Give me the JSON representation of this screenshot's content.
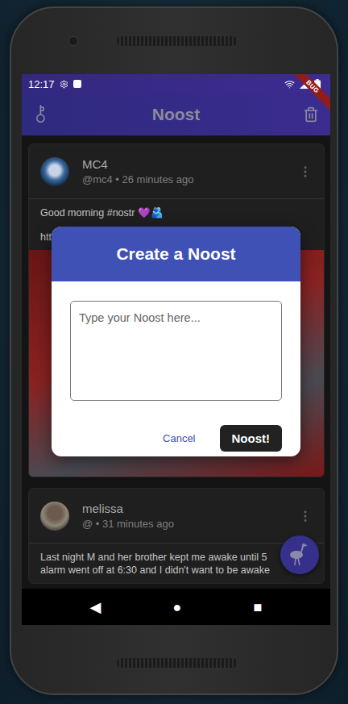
{
  "status_bar": {
    "time": "12:17",
    "debug_banner": "BUG"
  },
  "app_bar": {
    "title": "Noost"
  },
  "posts": [
    {
      "author": "MC4",
      "meta": "@mc4 • 26 minutes ago",
      "lines": [
        "Good morning #nostr 💜🫂",
        "htt"
      ],
      "has_image": true
    },
    {
      "author": "melissa",
      "meta": "@ • 31 minutes ago",
      "lines": [
        "Last night M and her brother kept me awake until 5",
        "alarm went off at 6:30 and I didn't want to be awake"
      ],
      "has_image": false
    }
  ],
  "dialog": {
    "title": "Create a Noost",
    "placeholder": "Type your Noost here...",
    "buttons": [
      {
        "label": "Cancel",
        "kind": "text"
      },
      {
        "label": "Noost!",
        "kind": "filled"
      }
    ]
  },
  "nav_buttons": [
    "◀",
    "●",
    "■"
  ]
}
